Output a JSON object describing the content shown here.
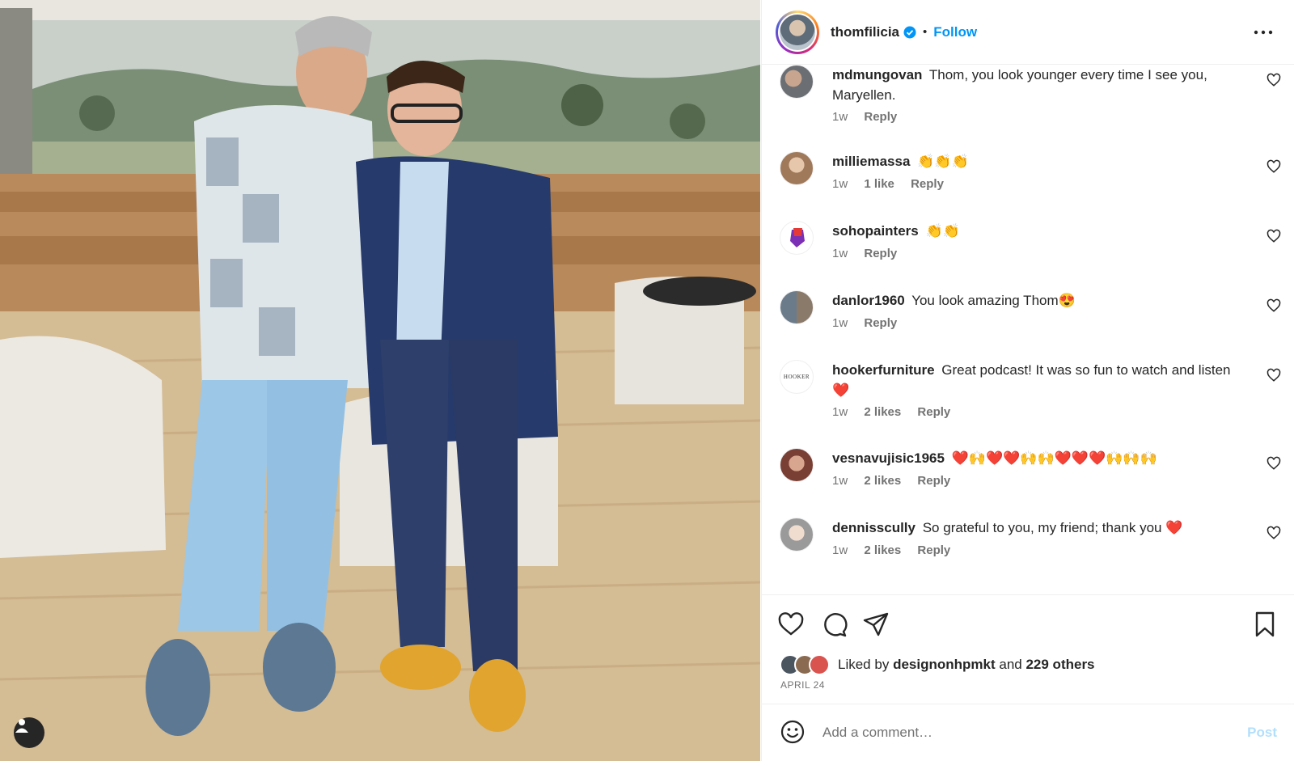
{
  "header": {
    "username": "thomfilicia",
    "separator": "•",
    "follow_label": "Follow",
    "avatar_icon": "profile-picture",
    "verified_icon": "verified-badge-icon",
    "more_icon": "more-options-icon"
  },
  "comments": [
    {
      "username": "mdmungovan",
      "text": "Thom, you look younger every time I see you, Maryellen.",
      "time": "1w",
      "likes": "",
      "reply": "Reply"
    },
    {
      "username": "milliemassa",
      "text": "👏👏👏",
      "time": "1w",
      "likes": "1 like",
      "reply": "Reply"
    },
    {
      "username": "sohopainters",
      "text": "👏👏",
      "time": "1w",
      "likes": "",
      "reply": "Reply"
    },
    {
      "username": "danlor1960",
      "text": "You look amazing Thom😍",
      "time": "1w",
      "likes": "",
      "reply": "Reply"
    },
    {
      "username": "hookerfurniture",
      "text": "Great podcast! It was so fun to watch and listen ❤️",
      "time": "1w",
      "likes": "2 likes",
      "reply": "Reply"
    },
    {
      "username": "vesnavujisic1965",
      "text": "❤️🙌❤️❤️🙌🙌❤️❤️❤️🙌🙌🙌",
      "time": "1w",
      "likes": "2 likes",
      "reply": "Reply"
    },
    {
      "username": "dennisscully",
      "text": "So grateful to you, my friend; thank you ❤️",
      "time": "1w",
      "likes": "2 likes",
      "reply": "Reply"
    }
  ],
  "hooker_logo": "HOOKER",
  "actions": {
    "like_icon": "heart-icon",
    "comment_icon": "comment-icon",
    "share_icon": "share-icon",
    "save_icon": "bookmark-icon"
  },
  "likes_summary": {
    "prefix": "Liked by",
    "user": "designonhpmkt",
    "joiner": "and",
    "others": "229 others"
  },
  "post_date": "APRIL 24",
  "comment_box": {
    "placeholder": "Add a comment…",
    "post_label": "Post",
    "emoji_icon": "emoji-icon"
  },
  "photo": {
    "tagged_icon": "tagged-user-icon"
  },
  "colors": {
    "accent": "#0095f6",
    "post_disabled": "#b2dffc",
    "text": "#262626",
    "muted": "#737373",
    "border": "#efefef"
  }
}
